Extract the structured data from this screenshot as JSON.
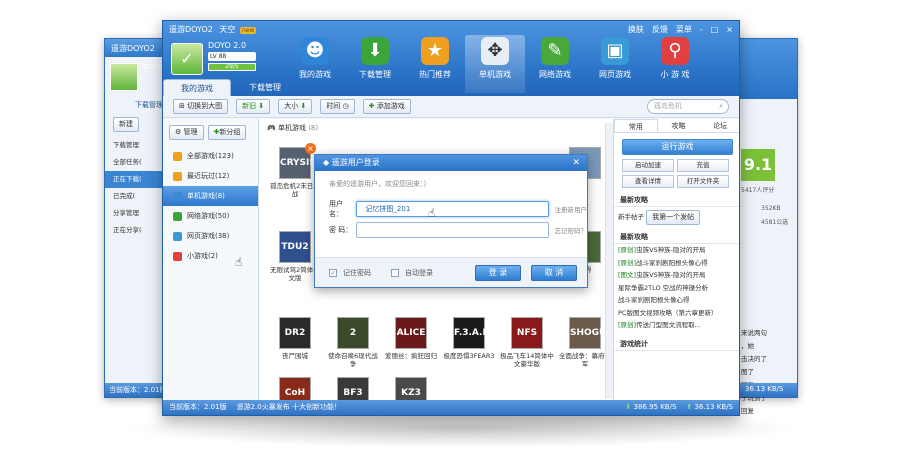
{
  "app": {
    "title": "遥游DOYO2",
    "tag_label": "天空",
    "tag_badge": "new",
    "username": "DOYO 2.0",
    "level": "LV 88",
    "exp": "29/5",
    "win_links": [
      "换肤",
      "反馈",
      "菜单"
    ],
    "win_buttons": [
      "-",
      "□",
      "×"
    ]
  },
  "nav": [
    {
      "label": "我的游戏",
      "icon": "person-icon",
      "glyph": "☻",
      "color": "#2f86d8",
      "active": false
    },
    {
      "label": "下载管理",
      "icon": "download-icon",
      "glyph": "⬇",
      "color": "#3aa63a",
      "active": false
    },
    {
      "label": "热门推荐",
      "icon": "recommend-icon",
      "glyph": "★",
      "color": "#f0a020",
      "active": false
    },
    {
      "label": "单机游戏",
      "icon": "gamepad-icon",
      "glyph": "✥",
      "color": "#e8eef6",
      "active": true
    },
    {
      "label": "网络游戏",
      "icon": "pen-icon",
      "glyph": "✎",
      "color": "#4aa83a",
      "active": false
    },
    {
      "label": "网页游戏",
      "icon": "webpage-icon",
      "glyph": "▣",
      "color": "#3a9ad8",
      "active": false
    },
    {
      "label": "小 游 戏",
      "icon": "joystick-icon",
      "glyph": "⚲",
      "color": "#e04040",
      "active": false
    }
  ],
  "tabs": [
    "我的游戏",
    "下载管理"
  ],
  "toolbar": {
    "switch_label": "切换到大图",
    "new_label": "新旧",
    "size_label": "大小",
    "time_label": "时间",
    "add_label": "添加游戏",
    "search_placeholder": "孤岛危机"
  },
  "sidebar": {
    "manage_label": "管理",
    "new_group_label": "新分组",
    "items": [
      {
        "label": "全部游戏(123)",
        "color": "#f0a020",
        "active": false
      },
      {
        "label": "最近玩过(12)",
        "color": "#f0a020",
        "active": false
      },
      {
        "label": "单机游戏(8)",
        "color": "#3a8ad8",
        "active": true
      },
      {
        "label": "网络游戏(50)",
        "color": "#3aa63a",
        "active": false
      },
      {
        "label": "网页游戏(38)",
        "color": "#3a9ad8",
        "active": false
      },
      {
        "label": "小游戏(2)",
        "color": "#e04040",
        "active": false
      }
    ]
  },
  "content": {
    "category": "单机游戏",
    "category_count": "(8)",
    "games": [
      {
        "title": "孤岛危机2末日之战",
        "cover": "CRYSIS",
        "color": "#556070"
      },
      {
        "title": "无限试驾2简体中文版",
        "cover": "TDU2",
        "color": "#2f4f8f"
      },
      {
        "title": "丧尸围城",
        "cover": "DR2",
        "color": "#2a2a2a"
      },
      {
        "title": "使命召唤6现代战争",
        "cover": "2",
        "color": "#3a4a2a"
      },
      {
        "title": "爱丽丝：疯狂回归",
        "cover": "ALICE",
        "color": "#6a1a1a"
      },
      {
        "title": "极度恐惧3FEAR3",
        "cover": "F.3.A.R",
        "color": "#1a1a1a"
      },
      {
        "title": "极品飞车14简体中文豪华版",
        "cover": "NFS",
        "color": "#8a1a1a"
      },
      {
        "title": "全面战争：幕府将军",
        "cover": "SHOGUN",
        "color": "#6a5a4a"
      },
      {
        "title": "",
        "cover": "CoH",
        "color": "#8a2a1a"
      },
      {
        "title": "",
        "cover": "BF3",
        "color": "#3a3a3a"
      },
      {
        "title": "",
        "cover": "KZ3",
        "color": "#4a4a4a"
      },
      {
        "title": "世界",
        "cover": "",
        "color": "#4a6a3a"
      },
      {
        "title": "机",
        "cover": "",
        "color": "#7a9ab8"
      }
    ]
  },
  "right": {
    "tabs": [
      "常用",
      "攻略",
      "论坛"
    ],
    "run_label": "运行游戏",
    "buttons": [
      "启动加速",
      "充值",
      "查看详情",
      "打开文件夹"
    ],
    "latest_label": "最新攻略",
    "newbie_label": "新手帖子",
    "first_post_label": "我第一个发帖",
    "news_label": "最新攻略",
    "news": [
      {
        "tag": "[原创]",
        "text": "虫族VS神族-隐对的开局"
      },
      {
        "tag": "[原创]",
        "text": "战斗家刹剧阳根头像心得"
      },
      {
        "tag": "[图文]",
        "text": "虫族VS神族-隐对的开局"
      },
      {
        "tag": "",
        "text": "星际争霸2TLO 空战的神操分析"
      },
      {
        "tag": "",
        "text": "战斗家刹剧阳根头像心得"
      },
      {
        "tag": "",
        "text": "PC版图文视频攻略（第六章更新）"
      },
      {
        "tag": "[原创]",
        "text": "传送门型图文流程取..."
      }
    ],
    "stats_label": "游戏统计"
  },
  "status": {
    "version": "当前版本：2.01版",
    "notice": "遥游2.0火暴发布 十大创新功能！",
    "down_speed": "386.95 KB/S",
    "up_speed": "36.13 KB/S"
  },
  "dialog": {
    "title": "遥游用户登录",
    "hint": "亲爱的遥游用户，欢迎您回来：）",
    "user_label": "用户名：",
    "user_value": "记忆拼图_201",
    "register_label": "注册新用户",
    "pass_label": "密 码：",
    "forgot_label": "忘记密码？",
    "remember_label": "记住密码",
    "auto_label": "自动登录",
    "login_label": "登 录",
    "cancel_label": "取 消"
  },
  "back_left": {
    "title": "遥游DOYO2",
    "user": "DOYO",
    "tab": "下载管理",
    "new_label": "新建",
    "items": [
      "下载管理",
      "全部任务(",
      "正在下载(",
      "已完成(",
      "分享管理",
      "正在分享("
    ],
    "version": "当前版本：2.01版"
  },
  "back_right": {
    "score": "9.1",
    "players": "5417人评分",
    "dl1": "352KB",
    "dl2": "4581公选",
    "links": [
      "来说两句",
      "，她",
      "击决的了",
      "图了",
      "回复",
      "于玩到了",
      "回复"
    ],
    "speed": "36.13 KB/S"
  }
}
